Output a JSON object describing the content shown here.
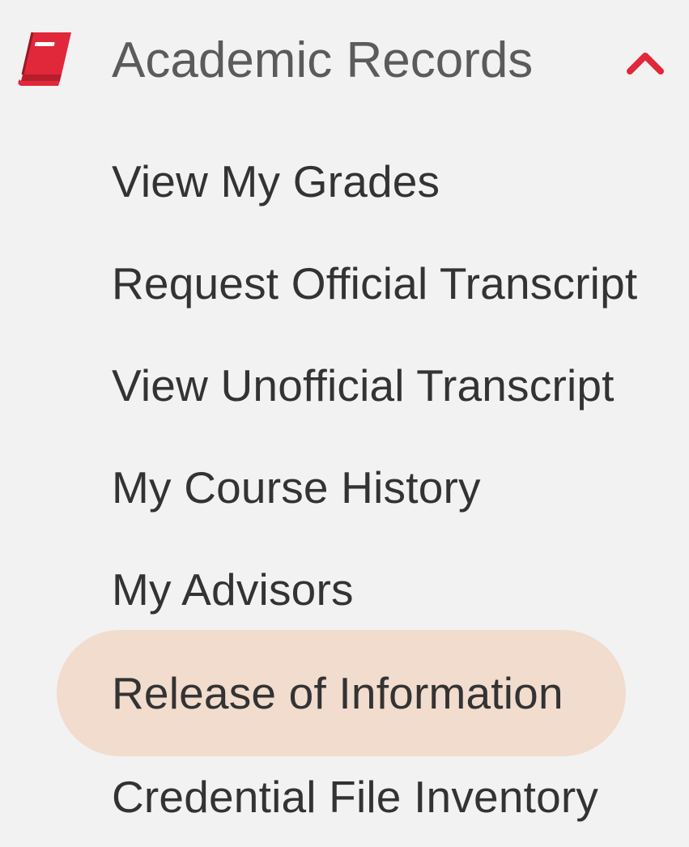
{
  "section": {
    "title": "Academic Records",
    "icon": "book-icon",
    "expanded_icon": "chevron-up-icon",
    "accent_color": "#e0283a"
  },
  "submenu": {
    "items": [
      {
        "label": "View My Grades"
      },
      {
        "label": "Request Official Transcript"
      },
      {
        "label": "View Unofficial Transcript"
      },
      {
        "label": "My Course History"
      },
      {
        "label": "My Advisors"
      },
      {
        "label": "Release of Information",
        "highlighted": true
      },
      {
        "label": "Credential File Inventory"
      }
    ]
  },
  "colors": {
    "background": "#f2f2f2",
    "highlight": "#f1dccd",
    "text": "#333333",
    "header_text": "#5b5b5b"
  }
}
